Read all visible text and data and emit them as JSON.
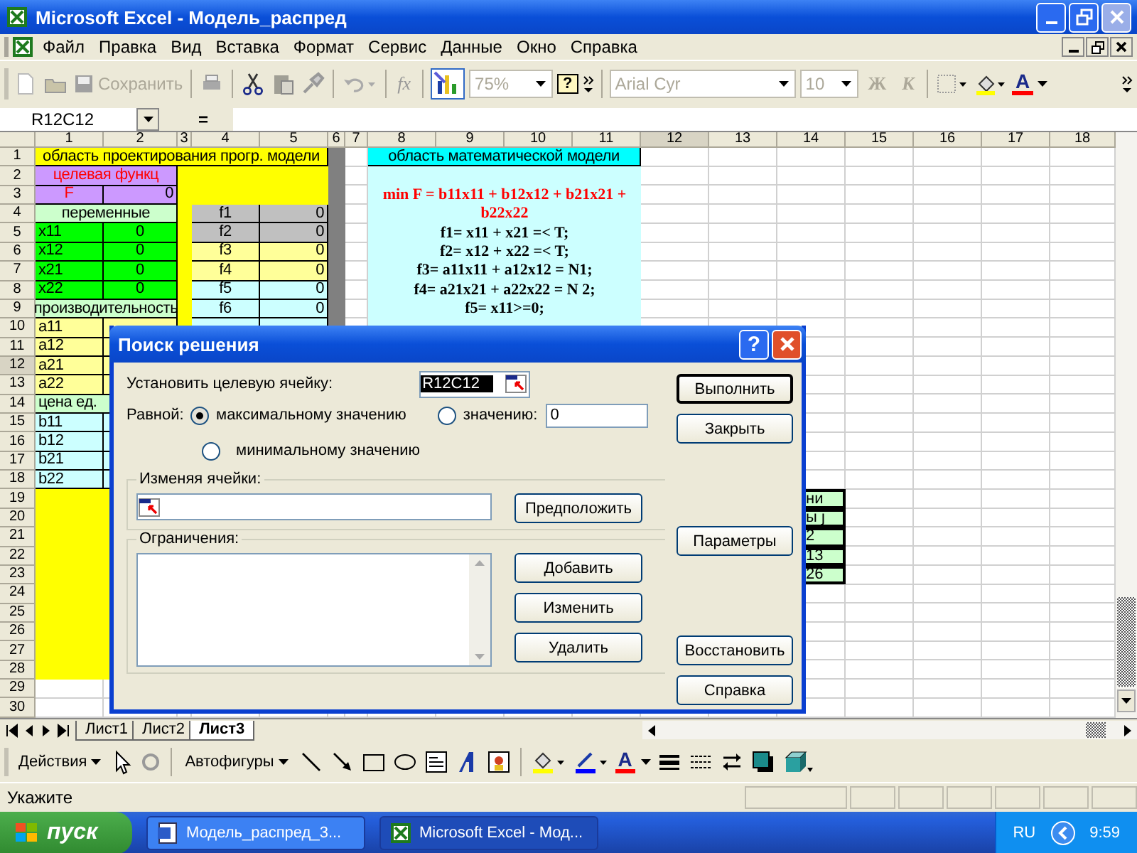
{
  "window": {
    "title": "Microsoft Excel - Модель_распред"
  },
  "menu": [
    {
      "label": "Файл"
    },
    {
      "label": "Правка"
    },
    {
      "label": "Вид"
    },
    {
      "label": "Вставка"
    },
    {
      "label": "Формат"
    },
    {
      "label": "Сервис"
    },
    {
      "label": "Данные"
    },
    {
      "label": "Окно"
    },
    {
      "label": "Справка"
    }
  ],
  "toolbar": {
    "save": "Сохранить",
    "function": "fx",
    "zoom": "75%",
    "help": "?",
    "font": "Arial Cyr",
    "size": "10",
    "bold": "Ж",
    "italic": "К",
    "font_color": "A"
  },
  "formula_bar": {
    "name_box": "R12C12",
    "equals": "="
  },
  "sheet": {
    "columns": [
      "1",
      "2",
      "3",
      "4",
      "5",
      "6",
      "7",
      "8",
      "9",
      "10",
      "11",
      "12",
      "13",
      "14",
      "15",
      "16",
      "17",
      "18"
    ],
    "rows": [
      "1",
      "2",
      "3",
      "4",
      "5",
      "6",
      "7",
      "8",
      "9",
      "10",
      "11",
      "12",
      "13",
      "14",
      "15",
      "16",
      "17",
      "18",
      "19",
      "20",
      "21",
      "22",
      "23",
      "24",
      "25",
      "26",
      "27",
      "28",
      "29",
      "30"
    ],
    "cells": [
      {
        "kind": "fill",
        "color": "#808080"
      },
      {
        "kind": "fill",
        "color": "#ffff00"
      },
      {
        "kind": "fill",
        "color": "#ffff00"
      },
      {
        "kind": "fill",
        "color": "#ffff00"
      },
      {
        "kind": "fill",
        "color": "#ccffff"
      },
      {
        "kind": "cell",
        "text": "область проектирования прогр. модели",
        "color": "#ffff00"
      },
      {
        "kind": "cell",
        "text": "целевая функц",
        "color": "#cc99ff",
        "accent": true
      },
      {
        "kind": "cell",
        "text": "F",
        "color": "#cc99ff",
        "accent": true
      },
      {
        "kind": "cell",
        "text": "0",
        "color": "#cc99ff"
      },
      {
        "kind": "cell",
        "text": "переменные",
        "color": "#ccffcc"
      },
      {
        "kind": "cell",
        "text": "f1",
        "color": "#c0c0c0"
      },
      {
        "kind": "cell",
        "text": "0",
        "color": "#c0c0c0"
      },
      {
        "kind": "cell",
        "text": "x11",
        "color": "#00ff00"
      },
      {
        "kind": "cell",
        "text": "0",
        "color": "#00ff00"
      },
      {
        "kind": "cell",
        "text": "f2",
        "color": "#c0c0c0"
      },
      {
        "kind": "cell",
        "text": "0",
        "color": "#c0c0c0"
      },
      {
        "kind": "cell",
        "text": "x12",
        "color": "#00ff00"
      },
      {
        "kind": "cell",
        "text": "0",
        "color": "#00ff00"
      },
      {
        "kind": "cell",
        "text": "f3",
        "color": "#ffff99"
      },
      {
        "kind": "cell",
        "text": "0",
        "color": "#ffff99"
      },
      {
        "kind": "cell",
        "text": "x21",
        "color": "#00ff00"
      },
      {
        "kind": "cell",
        "text": "0",
        "color": "#00ff00"
      },
      {
        "kind": "cell",
        "text": "f4",
        "color": "#ffff99"
      },
      {
        "kind": "cell",
        "text": "0",
        "color": "#ffff99"
      },
      {
        "kind": "cell",
        "text": "x22",
        "color": "#00ff00"
      },
      {
        "kind": "cell",
        "text": "0",
        "color": "#00ff00"
      },
      {
        "kind": "cell",
        "text": "f5",
        "color": "#ccffff"
      },
      {
        "kind": "cell",
        "text": "0",
        "color": "#ccffff"
      },
      {
        "kind": "cell",
        "text": "производительность",
        "color": "#ccffcc"
      },
      {
        "kind": "cell",
        "text": "f6",
        "color": "#ccffff"
      },
      {
        "kind": "cell",
        "text": "0",
        "color": "#ccffff"
      },
      {
        "kind": "cell",
        "text": "a11",
        "color": "#ffff99"
      },
      {
        "kind": "cell",
        "color": "#ffff99"
      },
      {
        "kind": "cell",
        "color": "#ccffff"
      },
      {
        "kind": "cell",
        "color": "#ccffff"
      },
      {
        "kind": "cell",
        "text": "a12",
        "color": "#ffff99"
      },
      {
        "kind": "cell",
        "color": "#ffff99"
      },
      {
        "kind": "cell",
        "text": "a21",
        "color": "#ffff99"
      },
      {
        "kind": "cell",
        "color": "#ffff99"
      },
      {
        "kind": "cell",
        "text": "a22",
        "color": "#ffff99"
      },
      {
        "kind": "cell",
        "color": "#ffff99"
      },
      {
        "kind": "cell",
        "text": "цена ед.",
        "color": "#ccffcc"
      },
      {
        "kind": "cell",
        "text": "b11",
        "color": "#ccffff"
      },
      {
        "kind": "cell",
        "color": "#ccffff"
      },
      {
        "kind": "cell",
        "text": "b12",
        "color": "#ccffff"
      },
      {
        "kind": "cell",
        "color": "#ccffff"
      },
      {
        "kind": "cell",
        "text": "b21",
        "color": "#ccffff"
      },
      {
        "kind": "cell",
        "color": "#ccffff"
      },
      {
        "kind": "cell",
        "text": "b22",
        "color": "#ccffff"
      },
      {
        "kind": "cell",
        "color": "#ccffff"
      },
      {
        "kind": "cell",
        "text": "область математической модели",
        "color": "#00ffff"
      },
      {
        "kind": "formula",
        "text": "min F = b11x11 + b12x12 + b21x21 + b22x22",
        "accent": true
      },
      {
        "kind": "formula",
        "text": "f1= x11 + x21 =< T;"
      },
      {
        "kind": "formula",
        "text": "f2= x12 + x22 =< T;"
      },
      {
        "kind": "formula",
        "text": "f3= a11x11 + a12x12 = N1;"
      },
      {
        "kind": "formula",
        "text": "f4= a21x21 + a22x22 = N 2;"
      },
      {
        "kind": "formula",
        "text": "f5= x11>=0;"
      },
      {
        "kind": "clipped",
        "text": "ни",
        "color": "#ccffcc"
      },
      {
        "kind": "clipped",
        "text": "ы j",
        "color": "#ccffcc"
      },
      {
        "kind": "clipped",
        "text": "2",
        "color": "#ccffcc"
      },
      {
        "kind": "clipped",
        "text": "13",
        "color": "#ccffcc"
      },
      {
        "kind": "clipped",
        "text": "26",
        "color": "#ccffcc"
      }
    ]
  },
  "sheet_tabs": [
    {
      "label": "Лист1",
      "selected": false
    },
    {
      "label": "Лист2",
      "selected": false
    },
    {
      "label": "Лист3",
      "selected": true
    }
  ],
  "drawing_toolbar": {
    "actions": "Действия",
    "autoshapes": "Автофигуры",
    "font_color": "A"
  },
  "status_bar": {
    "text": "Укажите"
  },
  "taskbar": {
    "start": "пуск",
    "tasks": [
      {
        "label": "Модель_распред_3...",
        "kind": "document",
        "selected": false
      },
      {
        "label": "Microsoft Excel - Мод...",
        "kind": "sheet",
        "selected": true
      }
    ],
    "language": "RU",
    "clock": "9:59"
  },
  "dialog": {
    "title": "Поиск решения",
    "help": "?",
    "target_label": "Установить целевую ячейку:",
    "target_value": "R12C12",
    "equal_label": "Равной:",
    "options": [
      {
        "label": "максимальному значению",
        "selected": true
      },
      {
        "label": "значению:",
        "selected": false
      },
      {
        "label": "минимальному значению",
        "selected": false
      }
    ],
    "value": "0",
    "changing_label": "Изменяя ячейки:",
    "guess": "Предположить",
    "constraints_label": "Ограничения:",
    "constraint_buttons": [
      {
        "label": "Добавить"
      },
      {
        "label": "Изменить"
      },
      {
        "label": "Удалить"
      }
    ],
    "side_buttons": [
      {
        "label": "Выполнить",
        "kind": "default"
      },
      {
        "label": "Закрыть",
        "kind": "normal"
      },
      {
        "label": "Параметры",
        "kind": "gap"
      },
      {
        "label": "Восстановить",
        "kind": "gap"
      },
      {
        "label": "Справка",
        "kind": "normal"
      }
    ]
  }
}
